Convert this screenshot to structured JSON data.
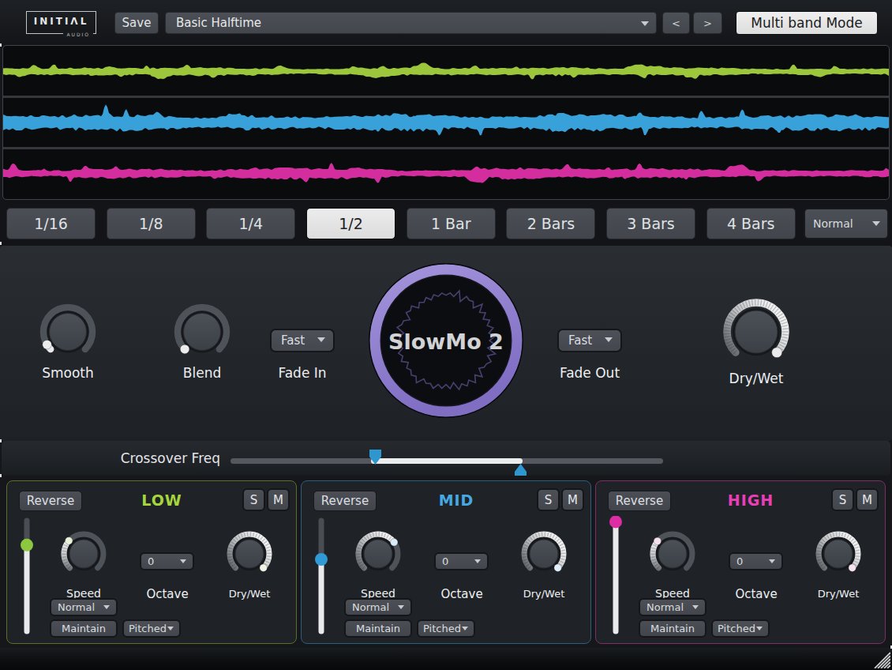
{
  "header": {
    "brand": "INITIΛL",
    "brand_sub": "AUDIO",
    "save_label": "Save",
    "preset_name": "Basic Halftime",
    "prev_label": "<",
    "next_label": ">",
    "mode_button_label": "Multi band Mode"
  },
  "waveforms": [
    {
      "name": "low-band-wave",
      "color": "#9cc73c",
      "seed": 11,
      "base_amp": 4.6,
      "peak_amp": 8
    },
    {
      "name": "mid-band-wave",
      "color": "#38a1d9",
      "seed": 42,
      "base_amp": 9.6,
      "peak_amp": 14
    },
    {
      "name": "high-band-wave",
      "color": "#d32d9e",
      "seed": 77,
      "base_amp": 6.0,
      "peak_amp": 9
    }
  ],
  "divisions": {
    "options": [
      "1/16",
      "1/8",
      "1/4",
      "1/2",
      "1 Bar",
      "2 Bars",
      "3 Bars",
      "4 Bars"
    ],
    "selected": "1/2",
    "mode_dropdown_value": "Normal"
  },
  "master": {
    "smooth": {
      "label": "Smooth",
      "value": 0.05
    },
    "blend": {
      "label": "Blend",
      "value": 0.0
    },
    "fade_in": {
      "label": "Fade In",
      "value": "Fast"
    },
    "fade_out": {
      "label": "Fade Out",
      "value": "Fast"
    },
    "drywet": {
      "label": "Dry/Wet",
      "value": 1.0
    },
    "logo_text": "SlowMo 2",
    "logo_ring_color": "#8d7cca",
    "logo_zigzag_color": "#493f6f"
  },
  "crossover": {
    "label": "Crossover Freq",
    "low_handle_pos": 0.335,
    "high_handle_pos": 0.67,
    "handle_color": "#2f97d0"
  },
  "bands": [
    {
      "title": "LOW",
      "accent": "#a6d63e",
      "border_color": "#5d6e28",
      "reverse_label": "Reverse",
      "solo_label": "S",
      "mute_label": "M",
      "level_slider": {
        "value": 0.78,
        "color": "#8dc63f"
      },
      "speed": {
        "label": "Speed",
        "value": 0.32,
        "dot_color": "#eaf3da"
      },
      "octave": {
        "label": "Octave",
        "value": "0"
      },
      "drywet": {
        "label": "Dry/Wet",
        "value": 1.0,
        "dot_color": "#f0f4e4"
      },
      "mode_dropdown_value": "Normal",
      "maintain_label": "Maintain",
      "pitch_dropdown_value": "Pitched"
    },
    {
      "title": "MID",
      "accent": "#47a9e3",
      "border_color": "#2b5f80",
      "reverse_label": "Reverse",
      "solo_label": "S",
      "mute_label": "M",
      "level_slider": {
        "value": 0.65,
        "color": "#2f9ad3"
      },
      "speed": {
        "label": "Speed",
        "value": 0.7,
        "dot_color": "#d9ecf8"
      },
      "octave": {
        "label": "Octave",
        "value": "0"
      },
      "drywet": {
        "label": "Dry/Wet",
        "value": 1.0,
        "dot_color": "#e2f0fa"
      },
      "mode_dropdown_value": "Normal",
      "maintain_label": "Maintain",
      "pitch_dropdown_value": "Pitched"
    },
    {
      "title": "HIGH",
      "accent": "#e93eb6",
      "border_color": "#7c2f63",
      "reverse_label": "Reverse",
      "solo_label": "S",
      "mute_label": "M",
      "level_slider": {
        "value": 0.99,
        "color": "#dd2da4"
      },
      "speed": {
        "label": "Speed",
        "value": 0.315,
        "dot_color": "#f6e0ee"
      },
      "octave": {
        "label": "Octave",
        "value": "0"
      },
      "drywet": {
        "label": "Dry/Wet",
        "value": 1.0,
        "dot_color": "#f7e4f0"
      },
      "mode_dropdown_value": "Normal",
      "maintain_label": "Maintain",
      "pitch_dropdown_value": "Pitched"
    }
  ]
}
